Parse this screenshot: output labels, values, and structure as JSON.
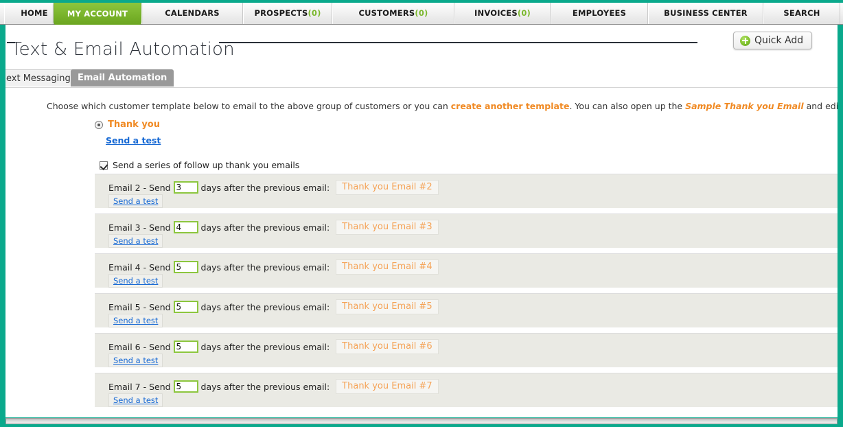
{
  "theme": {
    "frame_teal": "#0aa98c",
    "accent_green": "#8cc63e",
    "accent_orange": "#f08a24",
    "link_blue": "#1769d4",
    "row_gray": "#eaeae4"
  },
  "topnav": {
    "items": [
      {
        "label": "HOME",
        "count": null,
        "active": false
      },
      {
        "label": "MY ACCOUNT",
        "count": null,
        "active": true
      },
      {
        "label": "CALENDARS",
        "count": null,
        "active": false
      },
      {
        "label": "PROSPECTS",
        "count": "(0)",
        "active": false
      },
      {
        "label": "CUSTOMERS",
        "count": "(0)",
        "active": false
      },
      {
        "label": "INVOICES",
        "count": "(0)",
        "active": false
      },
      {
        "label": "EMPLOYEES",
        "count": null,
        "active": false
      },
      {
        "label": "BUSINESS CENTER",
        "count": null,
        "active": false
      },
      {
        "label": "SEARCH",
        "count": null,
        "active": false
      }
    ]
  },
  "header": {
    "title": "Text & Email Automation",
    "quick_add_label": "Quick Add",
    "quick_add_icon": "plus-circle-icon"
  },
  "tabs": [
    {
      "label": "ext Messaging",
      "active": false
    },
    {
      "label": "Email Automation",
      "active": true
    }
  ],
  "intro": {
    "part1": "Choose which customer template below to email to the above group of customers or you can ",
    "link1": "create another template",
    "part2": ". You can also open up the ",
    "link2": "Sample Thank you Email",
    "part3": " and edit/use it."
  },
  "template": {
    "radio_label": "Thank you",
    "radio_selected": true,
    "send_test_label": "Send a test"
  },
  "series": {
    "checkbox_label": "Send a series of follow up thank you emails",
    "checked": true,
    "rows": [
      {
        "prefix": "Email 2 - Send",
        "days": "3",
        "suffix": "days after the previous email:",
        "template": "Thank you Email #2",
        "send_test_label": "Send a test"
      },
      {
        "prefix": "Email 3 - Send",
        "days": "4",
        "suffix": "days after the previous email:",
        "template": "Thank you Email #3",
        "send_test_label": "Send a test"
      },
      {
        "prefix": "Email 4 - Send",
        "days": "5",
        "suffix": "days after the previous email:",
        "template": "Thank you Email #4",
        "send_test_label": "Send a test"
      },
      {
        "prefix": "Email 5 - Send",
        "days": "5",
        "suffix": "days after the previous email:",
        "template": "Thank you Email #5",
        "send_test_label": "Send a test"
      },
      {
        "prefix": "Email 6 - Send",
        "days": "5",
        "suffix": "days after the previous email:",
        "template": "Thank you Email #6",
        "send_test_label": "Send a test"
      },
      {
        "prefix": "Email 7 - Send",
        "days": "5",
        "suffix": "days after the previous email:",
        "template": "Thank you Email #7",
        "send_test_label": "Send a test"
      }
    ]
  }
}
